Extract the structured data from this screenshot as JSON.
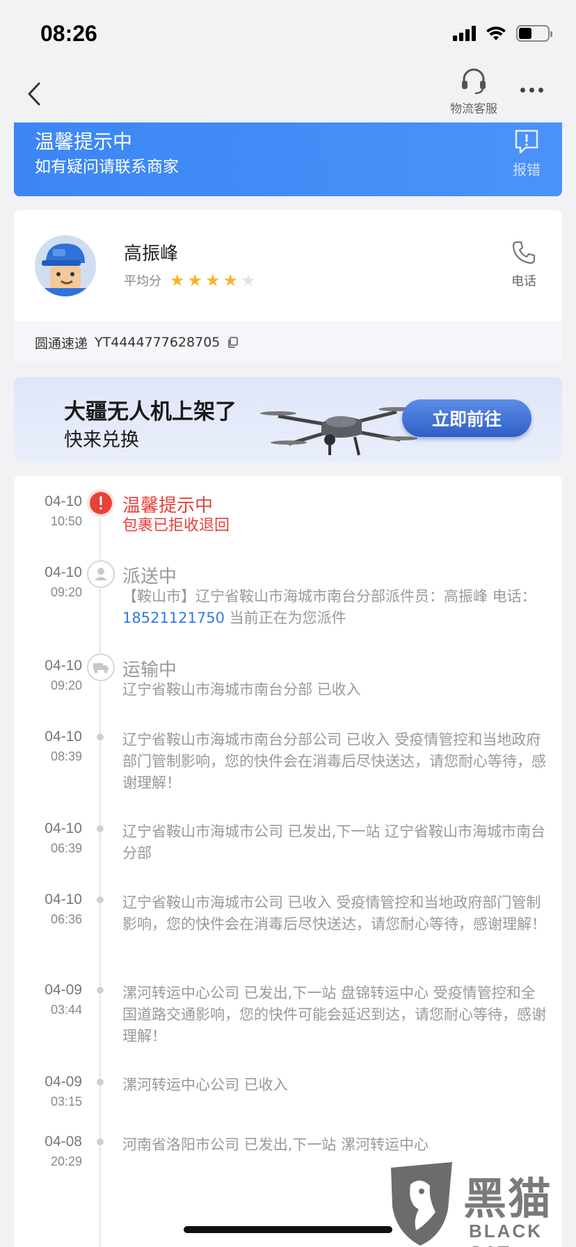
{
  "status_bar": {
    "time": "08:26",
    "battery_level": 0.45
  },
  "nav": {
    "customer_service_label": "物流客服"
  },
  "tip_banner": {
    "title": "温馨提示中",
    "subtitle": "如有疑问请联系商家",
    "report_label": "报错"
  },
  "courier": {
    "name": "高振峰",
    "rating_label": "平均分",
    "rating_stars": 4,
    "rating_max": 5,
    "phone_label": "电话",
    "carrier": "圆通速递",
    "tracking_number": "YT4444777628705"
  },
  "ad": {
    "title": "大疆无人机上架了",
    "subtitle": "快来兑换",
    "button": "立即前往"
  },
  "timeline": [
    {
      "date": "04-10",
      "time": "10:50",
      "title": "温馨提示中",
      "desc": "包裹已拒收退回",
      "icon": "alert-icon",
      "highlight": true
    },
    {
      "date": "04-10",
      "time": "09:20",
      "title": "派送中",
      "desc_before": "【鞍山市】辽宁省鞍山市海城市南台分部派件员：高振峰 电话：",
      "phone": "18521121750",
      "desc_after": " 当前正在为您派件",
      "icon": "courier-person-icon"
    },
    {
      "date": "04-10",
      "time": "09:20",
      "title": "运输中",
      "desc": "辽宁省鞍山市海城市南台分部 已收入",
      "icon": "truck-icon"
    },
    {
      "date": "04-10",
      "time": "08:39",
      "desc": "辽宁省鞍山市海城市南台分部公司 已收入 受疫情管控和当地政府部门管制影响，您的快件会在消毒后尽快送达，请您耐心等待，感谢理解！"
    },
    {
      "date": "04-10",
      "time": "06:39",
      "desc": "辽宁省鞍山市海城市公司 已发出,下一站 辽宁省鞍山市海城市南台分部"
    },
    {
      "date": "04-10",
      "time": "06:36",
      "desc": "辽宁省鞍山市海城市公司 已收入 受疫情管控和当地政府部门管制影响，您的快件会在消毒后尽快送达，请您耐心等待，感谢理解！"
    },
    {
      "date": "04-09",
      "time": "03:44",
      "desc": "漯河转运中心公司 已发出,下一站 盘锦转运中心 受疫情管控和全国道路交通影响，您的快件可能会延迟到达，请您耐心等待，感谢理解！"
    },
    {
      "date": "04-09",
      "time": "03:15",
      "desc": "漯河转运中心公司 已收入"
    },
    {
      "date": "04-08",
      "time": "20:29",
      "desc": "河南省洛阳市公司 已发出,下一站 漯河转运中心"
    }
  ],
  "watermark": {
    "text": "黑猫",
    "sub": "BLACK CAT"
  },
  "colors": {
    "accent_blue": "#3c86f4",
    "alert_red": "#e8413a",
    "star": "#f7b52c",
    "link": "#2f7be5"
  }
}
